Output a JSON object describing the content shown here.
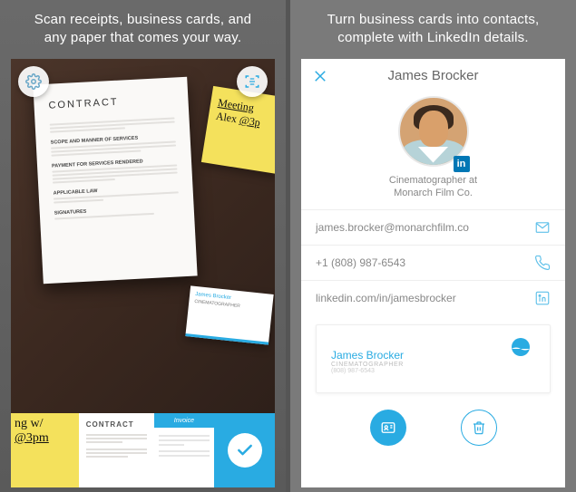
{
  "left": {
    "headline": "Scan receipts, business cards, and any paper that comes your way.",
    "paper": {
      "title": "CONTRACT",
      "sections": [
        "SCOPE AND MANNER OF SERVICES",
        "PAYMENT FOR SERVICES RENDERED",
        "APPLICABLE LAW",
        "SIGNATURES"
      ]
    },
    "sticky": {
      "line1": "Meeting",
      "line2": "Alex",
      "line3": "@3p"
    },
    "bizcard": {
      "name": "James Brocker",
      "role": "CINEMATOGRAPHER"
    },
    "thumbs": {
      "sticky": {
        "line1": "ng w/",
        "line2": "@3pm"
      },
      "contract_title": "CONTRACT",
      "invoice_title": "Invoice"
    }
  },
  "right": {
    "headline": "Turn business cards into contacts, complete with LinkedIn details.",
    "name": "James Brocker",
    "title_line1": "Cinematographer at",
    "title_line2": "Monarch Film Co.",
    "email": "james.brocker@monarchfilm.co",
    "phone": "+1 (808) 987-6543",
    "linkedin": "linkedin.com/in/jamesbrocker",
    "card_preview": {
      "name": "James Brocker",
      "role": "CINEMATOGRAPHER",
      "phone": "(808) 987-6543"
    },
    "linkedin_badge": "in"
  }
}
